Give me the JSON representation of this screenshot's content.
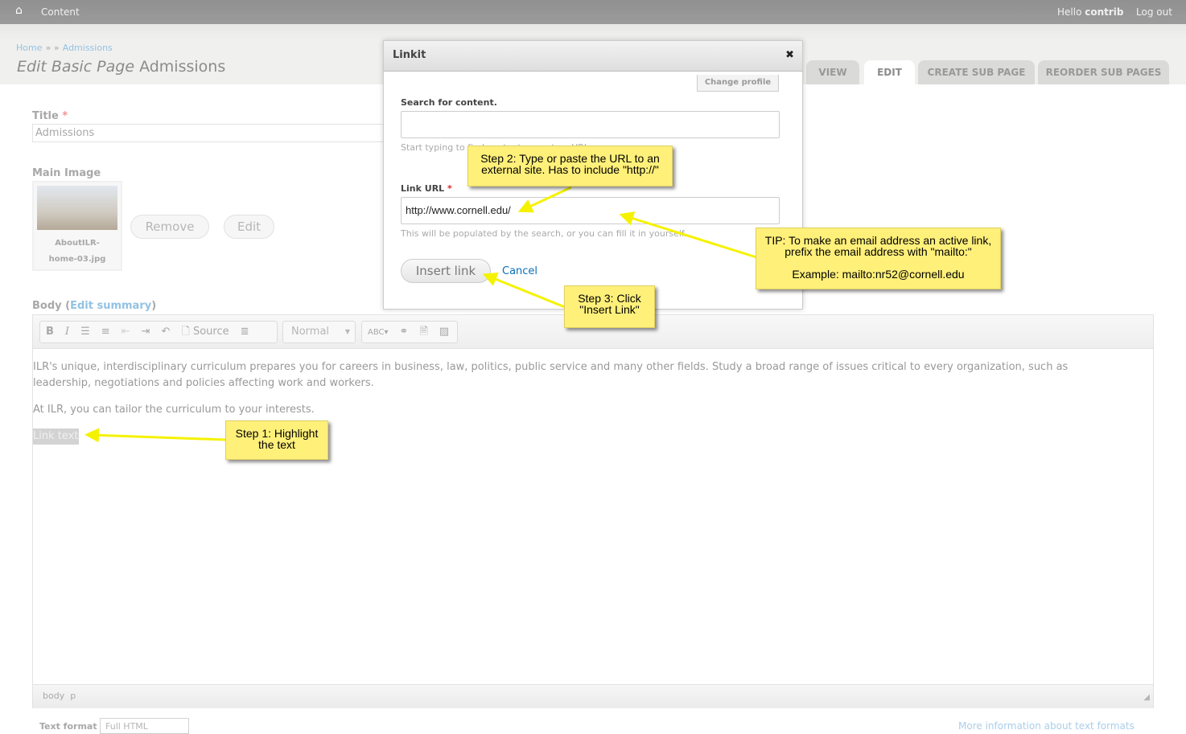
{
  "topbar": {
    "home_icon": "home-icon",
    "content": "Content",
    "hello": "Hello",
    "user": "contrib",
    "logout": "Log out"
  },
  "breadcrumb": {
    "home": "Home",
    "sep": "» »",
    "admissions": "Admissions"
  },
  "page_title": {
    "italic": "Edit Basic Page",
    "name": "Admissions"
  },
  "tabs": [
    "VIEW",
    "EDIT",
    "CREATE SUB PAGE",
    "REORDER SUB PAGES"
  ],
  "form": {
    "title_label": "Title",
    "required": "*",
    "title_value": "Admissions",
    "main_image_label": "Main Image",
    "image_filename_1": "AboutILR-",
    "image_filename_2": "home-03.jpg",
    "remove": "Remove",
    "edit": "Edit",
    "body_label": "Body (",
    "edit_summary": "Edit summary",
    "body_label_end": ")"
  },
  "toolbar": {
    "source": "Source",
    "format": "Normal"
  },
  "body": {
    "p1": "ILR's unique, interdisciplinary curriculum prepares you for careers in business, law, politics, public service and many other fields. Study a broad range of issues critical to every organization, such as leadership, negotiations and policies affecting work and workers.",
    "p2": "At ILR, you can tailor the curriculum to your interests.",
    "link_text": "Link text"
  },
  "statusbar": {
    "path": "body  p"
  },
  "text_format": {
    "label": "Text format",
    "value": "Full HTML",
    "more_info": "More information about text formats"
  },
  "dialog": {
    "title": "Linkit",
    "close": "✖",
    "change_profile": "Change profile",
    "search_label": "Search for content.",
    "search_value": "",
    "search_desc": "Start typing to find content or paste a URL.",
    "url_label": "Link URL",
    "url_required": "*",
    "url_value": "http://www.cornell.edu/",
    "url_desc": "This will be populated by the search, or you can fill it in yourself.",
    "insert": "Insert link",
    "cancel": "Cancel"
  },
  "callouts": {
    "step1": "Step 1: Highlight the text",
    "step2": "Step 2: Type or paste the URL to an external site. Has to include \"http://\"",
    "step3": "Step 3: Click \"Insert Link\"",
    "tip1": "TIP: To make an email address an active link, prefix the email address with \"mailto:\"",
    "tip2": "Example: mailto:nr52@cornell.edu"
  },
  "colors": {
    "callout": "#fff07a",
    "arrow": "#f5f200",
    "link": "#7fb8e0",
    "required": "#e05050"
  }
}
